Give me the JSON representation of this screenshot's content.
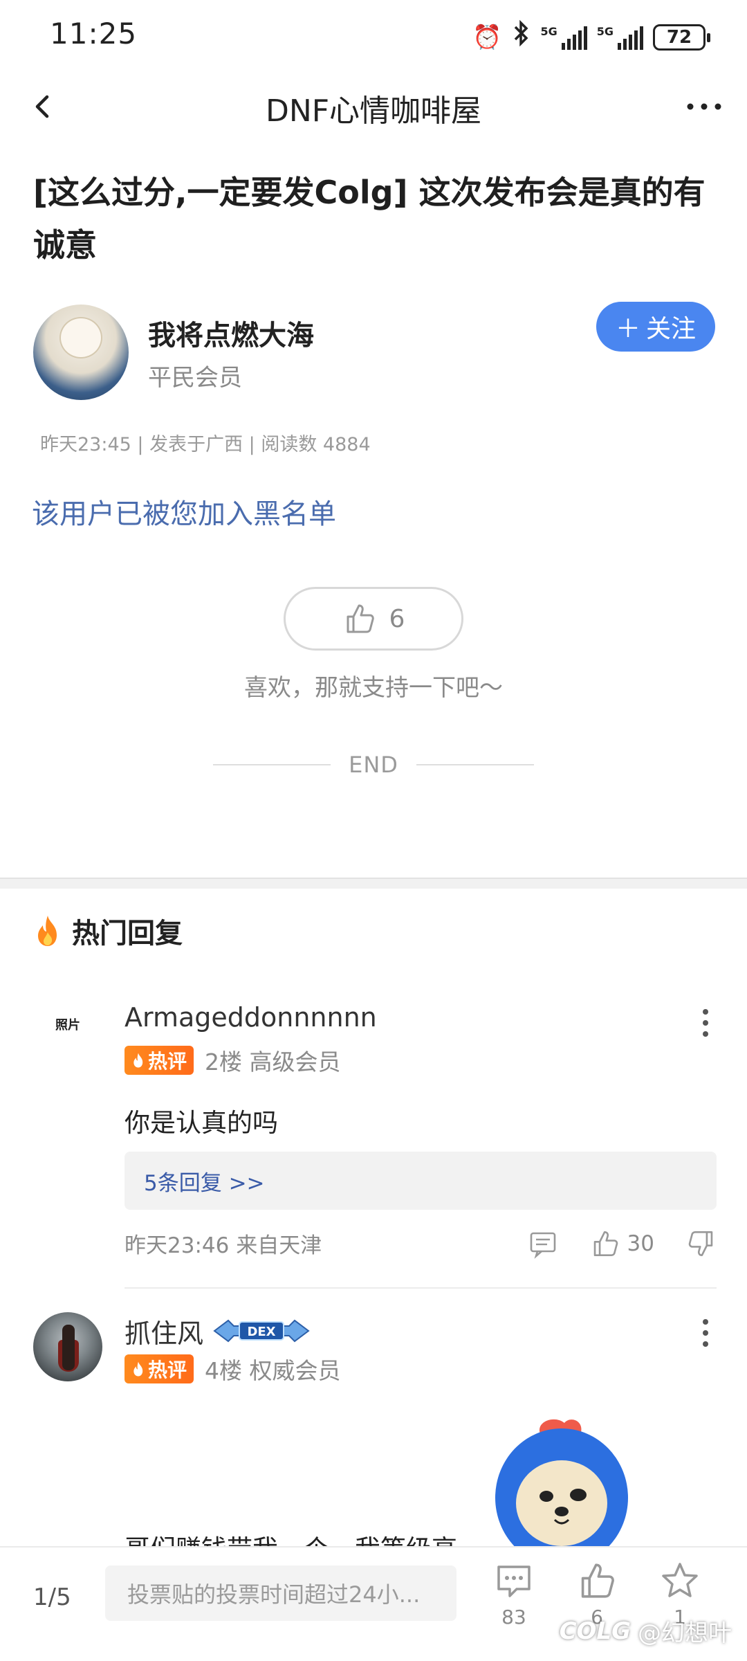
{
  "status_bar": {
    "time": "11:25",
    "network_1": "5G",
    "network_2": "5G",
    "battery": "72"
  },
  "nav": {
    "title": "DNF心情咖啡屋"
  },
  "post": {
    "title": "[这么过分,一定要发Colg] 这次发布会是真的有诚意",
    "author_name": "我将点燃大海",
    "author_level": "平民会员",
    "follow_label": "关注",
    "meta": "昨天23:45 | 发表于广西 | 阅读数 4884",
    "blacklist_note": "该用户已被您加入黑名单",
    "like_count": "6",
    "like_hint": "喜欢，那就支持一下吧～",
    "end_label": "END"
  },
  "hot_replies": {
    "header": "热门回复",
    "items": [
      {
        "avatar_text": "照片",
        "name": "Armageddonnnnnn",
        "badge": "热评",
        "floor_level": "2楼 高级会员",
        "content": "你是认真的吗",
        "sub_replies": "5条回复 >>",
        "time_location": "昨天23:46 来自天津",
        "likes": "30"
      },
      {
        "name": "抓住风",
        "rank_badge": "DEX",
        "badge": "热评",
        "floor_level": "4楼 权威会员",
        "partial_content": "哥们赚钱带我一个，我等级高"
      }
    ]
  },
  "bottom_bar": {
    "page_indicator": "1/5",
    "input_placeholder": "投票贴的投票时间超过24小...",
    "comment_count": "83",
    "like_count": "6",
    "favorite_count": "1",
    "watermark_logo": "COLG",
    "watermark_user": "@幻想叶"
  },
  "colors": {
    "accent_blue": "#4a86f0",
    "link_blue": "#4a6cae",
    "hot_orange": "#ff7a1e"
  }
}
